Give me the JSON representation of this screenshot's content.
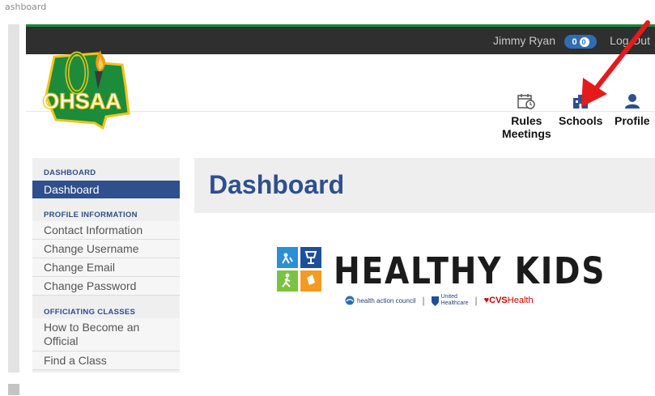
{
  "browser_tab": {
    "title": "ashboard"
  },
  "topbar": {
    "username": "Jimmy Ryan",
    "notifications_badge": "0",
    "notifications_badge_second": "0",
    "logout_label": "Log Out"
  },
  "logo": {
    "text": "OHSAA"
  },
  "nav": {
    "rules_meetings_line1": "Rules",
    "rules_meetings_line2": "Meetings",
    "schools_label": "Schools",
    "profile_label": "Profile"
  },
  "sidebar": {
    "section_dashboard": "DASHBOARD",
    "dashboard_item": "Dashboard",
    "section_profile": "PROFILE INFORMATION",
    "contact_info": "Contact Information",
    "change_username": "Change Username",
    "change_email": "Change Email",
    "change_password": "Change Password",
    "section_officiating": "OFFICIATING CLASSES",
    "how_to_become_1": "How to Become an",
    "how_to_become_2": "Official",
    "find_class": "Find a Class"
  },
  "main": {
    "title": "Dashboard"
  },
  "banner": {
    "title": "HEALTHY KIDS",
    "sponsor_1": "health action council",
    "sponsor_2_line1": "United",
    "sponsor_2_line2": "Healthcare",
    "sponsor_3_brand": "CVS",
    "sponsor_3_suffix": "Health"
  },
  "colors": {
    "topbar_bg": "#2f2f2f",
    "accent_blue": "#2f4f8d",
    "ohsaa_green": "#1c8c3a",
    "arrow_red": "#e51a1a"
  },
  "icons": {
    "rules_meetings": "calendar-clock-icon",
    "schools": "building-icon",
    "profile": "user-icon"
  }
}
